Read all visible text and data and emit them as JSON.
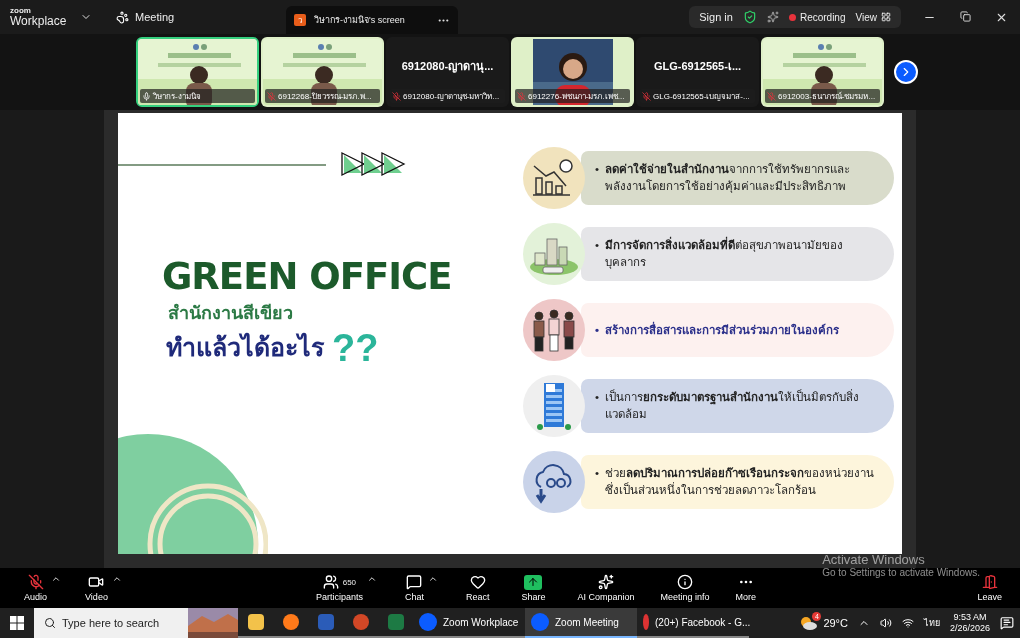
{
  "title_bar": {
    "logo_top": "zoom",
    "logo_bottom": "Workplace",
    "meeting_label": "Meeting",
    "share_tab": {
      "avatar": "ว",
      "label": "วิษากร-งามนิจ's screen"
    },
    "sign_in": "Sign in",
    "recording": "Recording",
    "view": "View"
  },
  "participants": [
    {
      "kind": "video",
      "name": "วิษากร-งามนิจ",
      "muted": false,
      "speaking": true
    },
    {
      "kind": "video",
      "name": "6912268-ปิยวรรณ-มรภ.พ...",
      "muted": true,
      "speaking": false
    },
    {
      "kind": "name",
      "display": "6912080-ญาดานุ...",
      "name": "6912080-ญาดานุช-มหาวิท...",
      "muted": true,
      "speaking": false
    },
    {
      "kind": "video",
      "name": "6912276-พชนภา-มรภ.เพช...",
      "muted": true,
      "speaking": false
    },
    {
      "kind": "name",
      "display": "GLG-6912565-เ...",
      "name": "GLG-6912565-เบญจมาส-...",
      "muted": true,
      "speaking": false
    },
    {
      "kind": "video",
      "name": "6912003-ธนาภรณ์-ชมรมห...",
      "muted": true,
      "speaking": false
    }
  ],
  "slide": {
    "bullet": "•",
    "title": "GREEN OFFICE",
    "subtitle": "สำนักงานสีเขียว",
    "question": "ทำแล้วได้อะไร",
    "question_marks": "??",
    "points": [
      {
        "kind": "plain",
        "text": "**ลดค่าใช้จ่ายในสำนักงาน**จากการใช้ทรัพยากรและพลังงานโดยการใช้อย่างคุ้มค่าและมีประสิทธิภาพ",
        "color": "#d9dccb"
      },
      {
        "kind": "plain",
        "text": "**มีการจัดการสิ่งแวดล้อมที่ดี**ต่อสุขภาพอนามัยของบุคลากร",
        "color": "#e5e5e8"
      },
      {
        "kind": "emphasis",
        "text": "สร้างการสื่อสารและการมีส่วนร่วมภายในองค์กร",
        "color": "#fdf1ef"
      },
      {
        "kind": "plain",
        "text": "เป็นการ**ยกระดับมาตรฐานสำนักงาน**ให้เป็นมิตรกับสิ่งแวดล้อม",
        "color": "#cfd7e9"
      },
      {
        "kind": "plain",
        "text": "ช่วย**ลดปริมาณการปล่อยก๊าซเรือนกระจก**ของหน่วยงานซึ่งเป็นส่วนหนึ่งในการช่วยลดภาวะโลกร้อน",
        "color": "#fdf5dc"
      }
    ]
  },
  "activation": {
    "title": "Activate Windows",
    "hint": "Go to Settings to activate Windows."
  },
  "toolbar": [
    {
      "kind": "audio",
      "label": "Audio",
      "muted": true,
      "caret": true
    },
    {
      "kind": "video",
      "label": "Video",
      "caret": true
    },
    {
      "kind": "participants",
      "label": "Participants",
      "count": "650",
      "caret": true
    },
    {
      "kind": "chat",
      "label": "Chat",
      "caret": true
    },
    {
      "kind": "react",
      "label": "React",
      "caret": false
    },
    {
      "kind": "share",
      "label": "Share",
      "caret": false
    },
    {
      "kind": "ai",
      "label": "AI Companion",
      "caret": false
    },
    {
      "kind": "info",
      "label": "Meeting info",
      "caret": false
    },
    {
      "kind": "more",
      "label": "More",
      "caret": false
    },
    {
      "kind": "leave",
      "label": "Leave",
      "caret": false
    }
  ],
  "taskbar": {
    "search_placeholder": "Type here to search",
    "apps": [
      {
        "kind": "folder",
        "selected": false
      },
      {
        "kind": "firefox",
        "selected": false
      },
      {
        "kind": "word",
        "selected": false
      },
      {
        "kind": "powerpoint",
        "selected": false
      },
      {
        "kind": "excel",
        "selected": false
      },
      {
        "kind": "zoom",
        "label": "Zoom Workplace",
        "selected": false
      },
      {
        "kind": "zoom",
        "label": "Zoom Meeting",
        "selected": true
      },
      {
        "kind": "chrome",
        "label": "(20+) Facebook - G...",
        "selected": false
      }
    ],
    "weather": "29°C",
    "badge": "4",
    "language": "ไทย",
    "time": "9:53 AM",
    "date": "2/26/2026"
  }
}
